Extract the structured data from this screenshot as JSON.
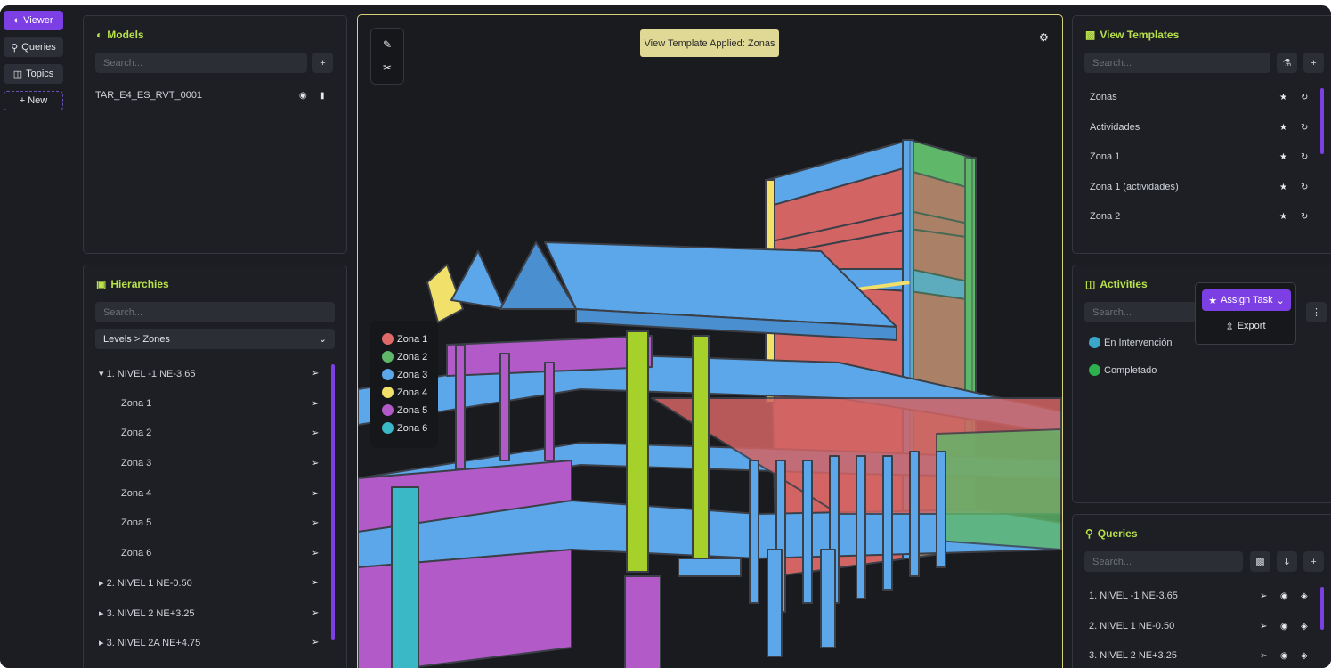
{
  "nav": {
    "viewer": "Viewer",
    "queries": "Queries",
    "topics": "Topics",
    "new": "+ New"
  },
  "models": {
    "title": "Models",
    "search_placeholder": "Search...",
    "add": "+",
    "items": [
      "TAR_E4_ES_RVT_0001"
    ]
  },
  "hierarchies": {
    "title": "Hierarchies",
    "search_placeholder": "Search...",
    "grouping": "Levels > Zones",
    "tree": [
      {
        "label": "▾ 1. NIVEL -1 NE-3.65",
        "depth": 0
      },
      {
        "label": "Zona 1",
        "depth": 1
      },
      {
        "label": "Zona 2",
        "depth": 1
      },
      {
        "label": "Zona 3",
        "depth": 1
      },
      {
        "label": "Zona 4",
        "depth": 1
      },
      {
        "label": "Zona 5",
        "depth": 1
      },
      {
        "label": "Zona 6",
        "depth": 1
      },
      {
        "label": "▸ 2. NIVEL 1 NE-0.50",
        "depth": 0
      },
      {
        "label": "▸ 3. NIVEL 2 NE+3.25",
        "depth": 0
      },
      {
        "label": "▸ 3. NIVEL 2A NE+4.75",
        "depth": 0
      }
    ]
  },
  "viewport": {
    "banner": "View Template Applied: Zonas",
    "legend": [
      {
        "label": "Zona 1",
        "color": "#e06a6a"
      },
      {
        "label": "Zona 2",
        "color": "#5fb86a"
      },
      {
        "label": "Zona 3",
        "color": "#5ca7ea"
      },
      {
        "label": "Zona 4",
        "color": "#f1e06a"
      },
      {
        "label": "Zona 5",
        "color": "#b35ac9"
      },
      {
        "label": "Zona 6",
        "color": "#3ab8c6"
      }
    ]
  },
  "view_templates": {
    "title": "View Templates",
    "search_placeholder": "Search...",
    "add": "+",
    "items": [
      "Zonas",
      "Actividades",
      "Zona 1",
      "Zona 1 (actividades)",
      "Zona 2"
    ]
  },
  "activities": {
    "title": "Activities",
    "search_placeholder": "Search...",
    "statuses": [
      {
        "label": "En Intervención",
        "color": "#3aa6c9"
      },
      {
        "label": "Completado",
        "color": "#2fb04f"
      }
    ],
    "menu": {
      "assign": "Assign Task",
      "export": "Export"
    }
  },
  "queries": {
    "title": "Queries",
    "search_placeholder": "Search...",
    "add": "+",
    "items": [
      "1. NIVEL -1 NE-3.65",
      "2. NIVEL 1 NE-0.50",
      "3. NIVEL 2 NE+3.25"
    ]
  }
}
